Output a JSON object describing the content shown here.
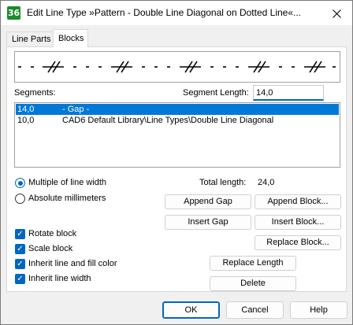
{
  "window": {
    "app_icon_text": "36",
    "title": "Edit Line Type »Pattern - Double Line Diagonal on Dotted Line«..."
  },
  "tabs": [
    {
      "label": "Line Parts",
      "active": false
    },
    {
      "label": "Blocks",
      "active": true
    }
  ],
  "segments": {
    "label": "Segments:",
    "segment_length_label": "Segment Length:",
    "segment_length_value": "14,0",
    "rows": [
      {
        "length": "14,0",
        "content": "- Gap -",
        "selected": true
      },
      {
        "length": "10,0",
        "content": "CAD6 Default Library\\Line Types\\Double Line Diagonal",
        "selected": false
      }
    ]
  },
  "units": {
    "multiple_label": "Multiple of line width",
    "absolute_label": "Absolute millimeters",
    "selected": "multiple"
  },
  "total": {
    "label": "Total length:",
    "value": "24,0"
  },
  "buttons": {
    "append_gap": "Append Gap",
    "append_block": "Append Block...",
    "insert_gap": "Insert Gap",
    "insert_block": "Insert Block...",
    "replace_block": "Replace Block...",
    "replace_length": "Replace Length",
    "delete": "Delete"
  },
  "checkboxes": [
    {
      "label": "Rotate block",
      "checked": true
    },
    {
      "label": "Scale block",
      "checked": true
    },
    {
      "label": "Inherit line and fill color",
      "checked": true
    },
    {
      "label": "Inherit line width",
      "checked": true
    }
  ],
  "footer": {
    "ok": "OK",
    "cancel": "Cancel",
    "help": "Help"
  },
  "colors": {
    "accent": "#0067c0",
    "selection": "#0078d7",
    "app_icon": "#1c8a2e"
  }
}
